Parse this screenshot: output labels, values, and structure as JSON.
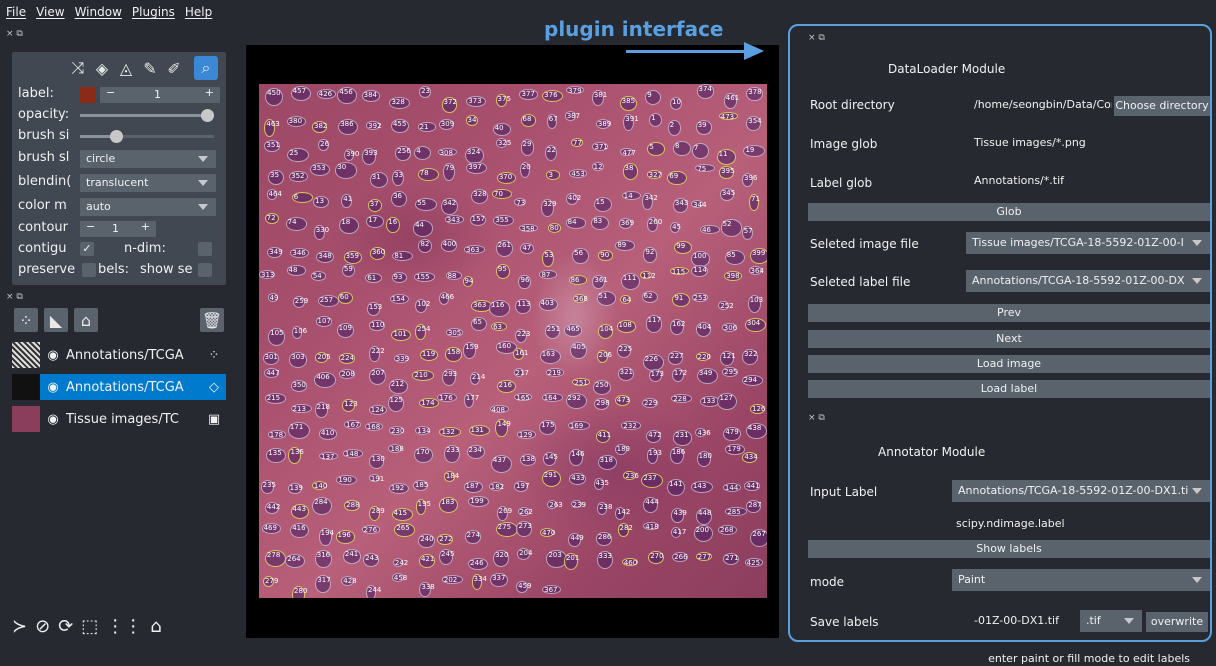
{
  "menu": [
    "File",
    "View",
    "Window",
    "Plugins",
    "Help"
  ],
  "dock_controls": "× ⧉",
  "layer_controls": {
    "label": {
      "name": "label:",
      "value": "1",
      "color": "#8b2a17"
    },
    "opacity": {
      "name": "opacity:",
      "value": 1.0
    },
    "brush_size": {
      "name": "brush si",
      "value": 0.25
    },
    "brush_shape": {
      "name": "brush sl",
      "value": "circle"
    },
    "blending": {
      "name": "blendin(",
      "value": "translucent"
    },
    "color_mode": {
      "name": "color m",
      "value": "auto"
    },
    "contour": {
      "name": "contour",
      "value": "1"
    },
    "contiguous": {
      "name": "contigu",
      "checked": true
    },
    "n_dim": {
      "name": "n-dim:",
      "checked": false
    },
    "preserve_labels": {
      "name": "preserve",
      "suffix": "bels:",
      "checked": false
    },
    "show_selected": {
      "name": "show se",
      "checked": false
    }
  },
  "layers": [
    {
      "name": "Annotations/TCGA",
      "icon": "points-icon",
      "selected": false
    },
    {
      "name": "Annotations/TCGA",
      "icon": "label-icon",
      "selected": true
    },
    {
      "name": "Tissue images/TC",
      "icon": "image-icon",
      "selected": false
    }
  ],
  "annotation": {
    "title": "plugin interface",
    "color": "#5aa0e0"
  },
  "nucleus_labels": [
    "450",
    "457",
    "426",
    "456",
    "384",
    "328",
    "23",
    "372",
    "373",
    "375",
    "377",
    "376",
    "379",
    "381",
    "385",
    "9",
    "10",
    "374",
    "461",
    "378",
    "463",
    "380",
    "382",
    "386",
    "392",
    "455",
    "21",
    "309",
    "34",
    "40",
    "68",
    "67",
    "387",
    "389",
    "391",
    "1",
    "2",
    "39",
    "473",
    "354",
    "351",
    "25",
    "26",
    "390",
    "393",
    "256",
    "4",
    "308",
    "324",
    "325",
    "29",
    "22",
    "77",
    "371",
    "477",
    "5",
    "8",
    "7",
    "11",
    "19",
    "35",
    "352",
    "353",
    "30",
    "31",
    "33",
    "78",
    "79",
    "397",
    "370",
    "20",
    "3",
    "453",
    "12",
    "38",
    "327",
    "69",
    "75",
    "395",
    "396",
    "464",
    "6",
    "13",
    "41",
    "37",
    "36",
    "55",
    "342",
    "328",
    "70",
    "73",
    "329",
    "402",
    "15",
    "14",
    "342",
    "343",
    "344",
    "345",
    "71",
    "72",
    "74",
    "330",
    "18",
    "17",
    "16",
    "44",
    "343",
    "157",
    "355",
    "358",
    "80",
    "84",
    "83",
    "369",
    "260",
    "45",
    "46",
    "52",
    "57",
    "349",
    "346",
    "348",
    "359",
    "360",
    "81",
    "82",
    "400",
    "363",
    "261",
    "47",
    "53",
    "56",
    "90",
    "89",
    "92",
    "99",
    "100",
    "85",
    "399",
    "313",
    "48",
    "54",
    "59",
    "61",
    "93",
    "155",
    "88",
    "94",
    "95",
    "96",
    "87",
    "86",
    "361",
    "111",
    "112",
    "115",
    "114",
    "398",
    "364",
    "49",
    "259",
    "257",
    "60",
    "153",
    "154",
    "102",
    "466",
    "363",
    "116",
    "113",
    "403",
    "368",
    "51",
    "64",
    "62",
    "91",
    "253",
    "252",
    "103",
    "105",
    "106",
    "107",
    "109",
    "110",
    "101",
    "254",
    "305",
    "65",
    "63",
    "223",
    "251",
    "465",
    "104",
    "108",
    "117",
    "162",
    "404",
    "306",
    "304",
    "301",
    "303",
    "205",
    "224",
    "222",
    "339",
    "119",
    "158",
    "159",
    "160",
    "161",
    "163",
    "405",
    "206",
    "225",
    "226",
    "227",
    "220",
    "121",
    "322",
    "447",
    "350",
    "406",
    "208",
    "207",
    "212",
    "210",
    "293",
    "214",
    "216",
    "217",
    "219",
    "251",
    "250",
    "321",
    "173",
    "172",
    "349",
    "295",
    "294",
    "215",
    "213",
    "218",
    "123",
    "124",
    "125",
    "174",
    "176",
    "177",
    "408",
    "165",
    "164",
    "292",
    "298",
    "473",
    "229",
    "228",
    "133",
    "127",
    "126",
    "178",
    "171",
    "410",
    "167",
    "168",
    "230",
    "134",
    "132",
    "131",
    "149",
    "129",
    "175",
    "169",
    "411",
    "232",
    "472",
    "231",
    "436",
    "479",
    "438",
    "135",
    "136",
    "137",
    "148",
    "130",
    "188",
    "170",
    "233",
    "234",
    "437",
    "138",
    "145",
    "146",
    "318",
    "189",
    "193",
    "186",
    "180",
    "179",
    "434",
    "235",
    "139",
    "140",
    "190",
    "191",
    "192",
    "185",
    "184",
    "187",
    "182",
    "197",
    "291",
    "433",
    "435",
    "236",
    "237",
    "141",
    "143",
    "144",
    "441",
    "442",
    "443",
    "284",
    "288",
    "289",
    "415",
    "195",
    "183",
    "199",
    "269",
    "262",
    "263",
    "239",
    "238",
    "142",
    "444",
    "439",
    "448",
    "285",
    "287",
    "469",
    "416",
    "194",
    "196",
    "276",
    "265",
    "240",
    "272",
    "274",
    "275",
    "273",
    "470",
    "449",
    "286",
    "282",
    "418",
    "417",
    "200",
    "268",
    "267",
    "278",
    "264",
    "316",
    "241",
    "243",
    "242",
    "421",
    "245",
    "246",
    "320",
    "204",
    "203",
    "201",
    "333",
    "460",
    "270",
    "266",
    "277",
    "271",
    "425",
    "279",
    "280",
    "317",
    "428",
    "244",
    "458",
    "338",
    "202",
    "334",
    "337",
    "459",
    "367"
  ],
  "dataloader": {
    "title": "DataLoader Module",
    "root_label": "Root directory",
    "root_value": "/home/seongbin/Data/Cor",
    "choose_dir": "Choose directory",
    "image_glob_label": "Image glob",
    "image_glob_value": "Tissue images/*.png",
    "label_glob_label": "Label glob",
    "label_glob_value": "Annotations/*.tif",
    "glob_btn": "Glob",
    "sel_image_label": "Seleted image file",
    "sel_image_value": "Tissue images/TCGA-18-5592-01Z-00-I",
    "sel_label_label": "Seleted label file",
    "sel_label_value": "Annotations/TCGA-18-5592-01Z-00-DX",
    "prev": "Prev",
    "next": "Next",
    "load_image": "Load image",
    "load_label": "Load label"
  },
  "annotator": {
    "title": "Annotator Module",
    "input_label_label": "Input Label",
    "input_label_value": "Annotations/TCGA-18-5592-01Z-00-DX1.ti",
    "scipy_text": "scipy.ndimage.label",
    "show_labels": "Show labels",
    "mode_label": "mode",
    "mode_value": "Paint",
    "save_label": "Save labels",
    "save_value": "-01Z-00-DX1.tif",
    "ext_value": ".tif",
    "overwrite": "overwrite"
  },
  "status": "enter paint or fill mode to edit labels"
}
